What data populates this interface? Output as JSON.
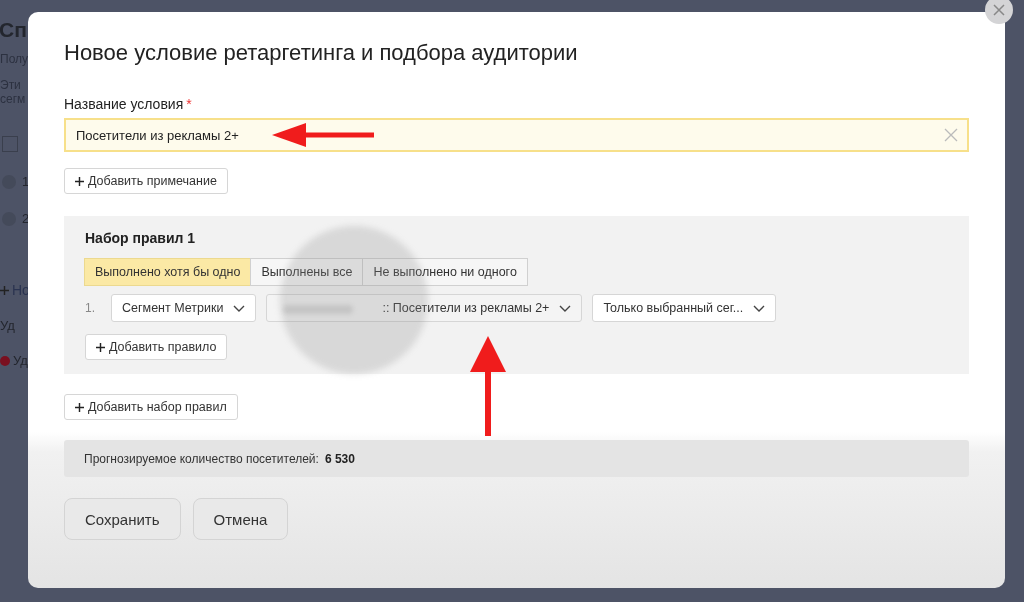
{
  "background_page": {
    "title": "Сп",
    "lines": [
      "Полу",
      "Эти",
      "сегм"
    ],
    "checkbox": {
      "checked": false
    },
    "rows": [
      "1",
      "2"
    ],
    "link": "Но",
    "items": [
      {
        "label": "Уд",
        "kind": "plain"
      },
      {
        "label": "Уд",
        "kind": "error"
      }
    ]
  },
  "dialog": {
    "title": "Новое условие ретаргетинга и подбора аудитории",
    "name_field": {
      "label": "Название условия",
      "required_mark": "*",
      "value": "Посетители из рекламы 2+"
    },
    "add_note_button": "Добавить примечание",
    "rule_sets": [
      {
        "title": "Набор правил 1",
        "modes": [
          {
            "label": "Выполнено хотя бы одно",
            "selected": true
          },
          {
            "label": "Выполнены все",
            "selected": false
          },
          {
            "label": "Не выполнено ни одного",
            "selected": false
          }
        ],
        "rules": [
          {
            "number": "1.",
            "type": "Сегмент Метрики",
            "segment": ":: Посетители из рекламы 2+",
            "scope": "Только выбранный сег..."
          }
        ],
        "add_rule_button": "Добавить правило"
      }
    ],
    "add_rule_set_button": "Добавить набор правил",
    "forecast": {
      "label": "Прогнозируемое количество посетителей:",
      "value": "6 530"
    },
    "buttons": [
      "Сохранить",
      "Отмена"
    ]
  }
}
